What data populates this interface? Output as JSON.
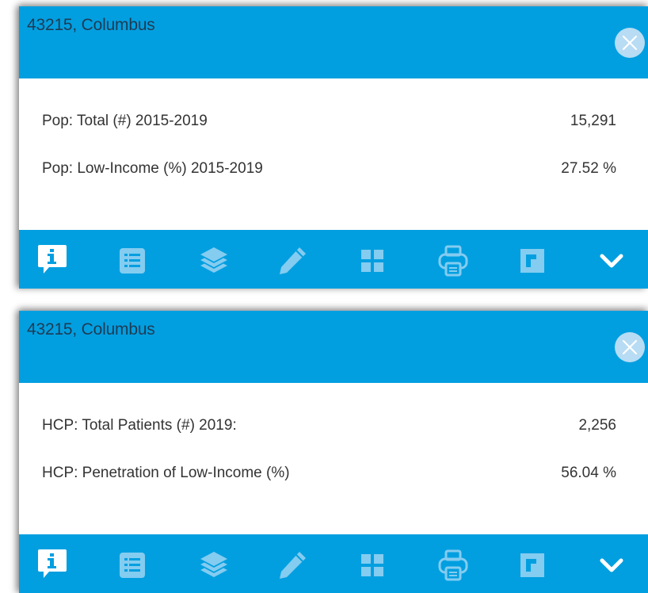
{
  "colors": {
    "header_bg": "#029fe0",
    "toolbar_bg": "#029fe0",
    "title_text": "#1f3b53",
    "icon_active": "#ffffff",
    "icon_inactive": "#84ccf0",
    "close_bg": "#b7dcf4"
  },
  "popups": [
    {
      "title": "43215, Columbus",
      "rows": [
        {
          "label": "Pop: Total (#) 2015-2019",
          "value": "15,291"
        },
        {
          "label": "Pop: Low-Income (%) 2015-2019",
          "value": "27.52 %"
        }
      ]
    },
    {
      "title": "43215, Columbus",
      "rows": [
        {
          "label": "HCP: Total Patients (#) 2019:",
          "value": "2,256"
        },
        {
          "label": "HCP: Penetration of Low-Income (%)",
          "value": "56.04 %"
        }
      ]
    }
  ],
  "toolbar": {
    "icons": [
      "info-icon",
      "list-icon",
      "layers-icon",
      "pencil-icon",
      "grid-icon",
      "print-icon",
      "square-icon",
      "chevron-down-icon"
    ],
    "active": "info-icon"
  }
}
